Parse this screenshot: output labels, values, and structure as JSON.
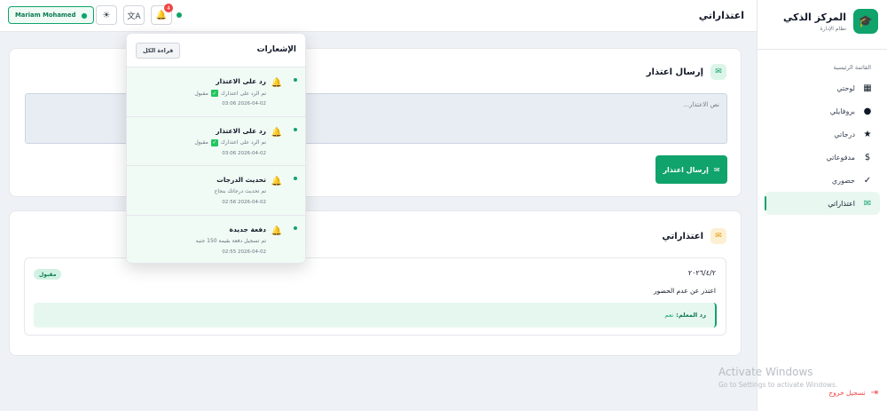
{
  "brand": {
    "name": "المركز الذكي",
    "subtitle": "نظام الإدارة",
    "logo_icon": "graduation-cap-icon"
  },
  "sidebar": {
    "section_label": "القائمة الرئيسية",
    "items": [
      {
        "label": "لوحتي",
        "icon": "dashboard-icon",
        "glyph": "▦",
        "active": false
      },
      {
        "label": "بروفايلي",
        "icon": "user-icon",
        "glyph": "👤",
        "active": false
      },
      {
        "label": "درجاتي",
        "icon": "star-icon",
        "glyph": "★",
        "active": false
      },
      {
        "label": "مدفوعاتي",
        "icon": "dollar-icon",
        "glyph": "$",
        "active": false
      },
      {
        "label": "حضوري",
        "icon": "check-icon",
        "glyph": "✓",
        "active": false
      },
      {
        "label": "اعتذاراتي",
        "icon": "mail-icon",
        "glyph": "✉",
        "active": true
      }
    ],
    "logout_label": "تسجيل خروج"
  },
  "header": {
    "title": "اعتذاراتي",
    "user_name": "Mariam Mohamed",
    "notification_count": "4"
  },
  "send_card": {
    "title": "إرسال اعتذار",
    "textarea_placeholder": "نص الاعتذار...",
    "send_button": "إرسال اعتذار"
  },
  "my_excuses": {
    "title": "اعتذاراتي",
    "items": [
      {
        "date": "٢٠٢٦/٤/٢",
        "status": "مقبول",
        "text": "اعتذر عن عدم الحضور",
        "reply_label": "رد المعلم:",
        "reply_text": "نعم"
      }
    ]
  },
  "notifications": {
    "title": "الإشعارات",
    "read_all": "قراءة الكل",
    "items": [
      {
        "title": "رد على الاعتذار",
        "body": "تم الرد على اعتذارك",
        "status": "مقبول",
        "time": "2026-04-02 03:06"
      },
      {
        "title": "رد على الاعتذار",
        "body": "تم الرد على اعتذارك",
        "status": "مقبول",
        "time": "2026-04-02 03:06"
      },
      {
        "title": "تحديث الدرجات",
        "body": "تم تحديث درجاتك بنجاح",
        "status": "",
        "time": "2026-04-02 02:56"
      },
      {
        "title": "دفعة جديدة",
        "body": "تم تسجيل دفعة بقيمة 150 جنيه",
        "status": "",
        "time": "2026-04-02 02:55"
      }
    ]
  },
  "watermark": {
    "line1": "Activate Windows",
    "line2": "Go to Settings to activate Windows."
  },
  "colors": {
    "accent": "#10a36b",
    "danger": "#ef4444",
    "warning": "#e59b0a"
  }
}
